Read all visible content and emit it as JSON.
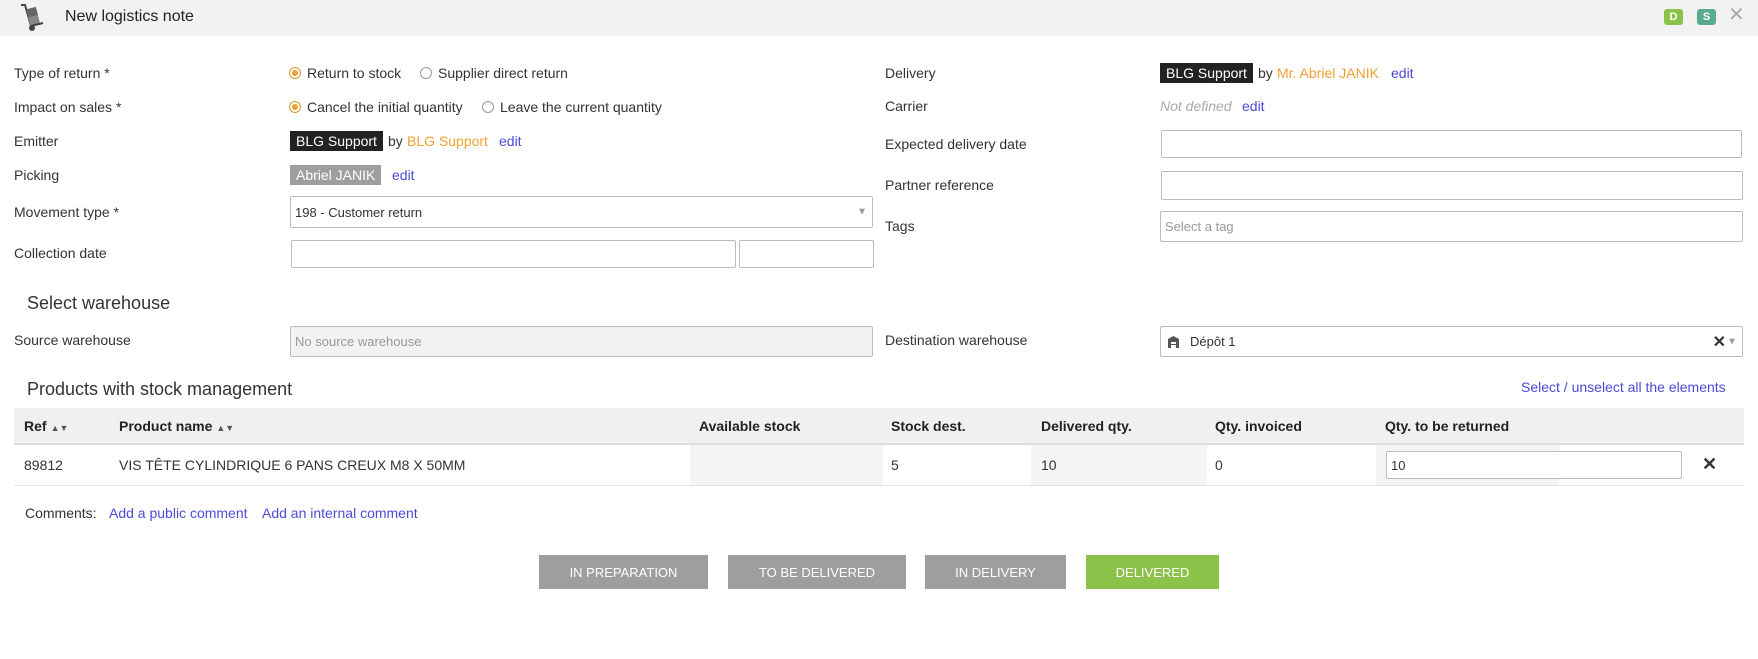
{
  "header": {
    "title": "New logistics note",
    "badge_d": "D",
    "badge_s": "S",
    "close": "✕"
  },
  "form": {
    "type_of_return": {
      "label": "Type of return *",
      "options": [
        "Return to stock",
        "Supplier direct return"
      ],
      "selected": "Return to stock"
    },
    "impact_on_sales": {
      "label": "Impact on sales *",
      "options": [
        "Cancel the initial quantity",
        "Leave the current quantity"
      ],
      "selected": "Cancel the initial quantity"
    },
    "emitter": {
      "label": "Emitter",
      "entity": "BLG Support",
      "by": "by",
      "person": "BLG Support",
      "edit": "edit"
    },
    "picking": {
      "label": "Picking",
      "person": "Abriel JANIK",
      "edit": "edit"
    },
    "movement_type": {
      "label": "Movement type *",
      "value": "198 - Customer return"
    },
    "collection_date": {
      "label": "Collection date"
    },
    "delivery": {
      "label": "Delivery",
      "entity": "BLG Support",
      "by": "by",
      "person": "Mr. Abriel JANIK",
      "edit": "edit"
    },
    "carrier": {
      "label": "Carrier",
      "value": "Not defined",
      "edit": "edit"
    },
    "expected_delivery_date": {
      "label": "Expected delivery date"
    },
    "partner_reference": {
      "label": "Partner reference"
    },
    "tags": {
      "label": "Tags",
      "placeholder": "Select a tag"
    }
  },
  "warehouse": {
    "section_title": "Select warehouse",
    "source_label": "Source warehouse",
    "source_placeholder": "No source warehouse",
    "destination_label": "Destination warehouse",
    "destination_value": "Dépôt 1"
  },
  "products": {
    "section_title": "Products with stock management",
    "select_all": "Select / unselect all the elements",
    "columns": [
      "Ref",
      "Product name",
      "Available stock",
      "Stock dest.",
      "Delivered qty.",
      "Qty. invoiced",
      "Qty. to be returned"
    ],
    "rows": [
      {
        "ref": "89812",
        "name": "VIS TÊTE CYLINDRIQUE 6 PANS CREUX M8 X 50MM",
        "available_stock": "",
        "stock_dest": "5",
        "delivered_qty": "10",
        "qty_invoiced": "0",
        "qty_to_return": "10"
      }
    ]
  },
  "comments": {
    "label": "Comments:",
    "add_public": "Add a public comment",
    "add_internal": "Add an internal comment"
  },
  "status_buttons": [
    "IN PREPARATION",
    "TO BE DELIVERED",
    "IN DELIVERY",
    "DELIVERED"
  ],
  "colors": {
    "accent_orange": "#f0a030",
    "link_blue": "#4b4bd6",
    "delivered_green": "#8bc34a",
    "status_gray": "#9e9e9e"
  }
}
